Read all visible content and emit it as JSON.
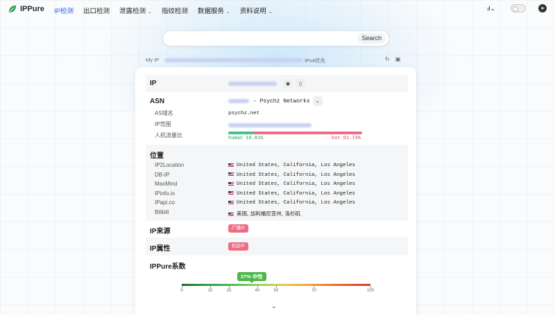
{
  "nav": {
    "brand": "IPPure",
    "items": [
      {
        "label": "IP检测",
        "active": true,
        "dropdown": false
      },
      {
        "label": "出口检测",
        "active": false,
        "dropdown": false
      },
      {
        "label": "泄露检测",
        "active": false,
        "dropdown": true
      },
      {
        "label": "指纹检测",
        "active": false,
        "dropdown": false
      },
      {
        "label": "数据服务",
        "active": false,
        "dropdown": true
      },
      {
        "label": "资料说明",
        "active": false,
        "dropdown": true
      }
    ],
    "brand_color": "#2e9e4f",
    "active_color": "#2563eb"
  },
  "search": {
    "button_label": "Search"
  },
  "myip": {
    "label": "My IP",
    "preference": "IPv4优先"
  },
  "ip_section": {
    "label": "IP"
  },
  "asn": {
    "label": "ASN",
    "org": "- Psychz Networks",
    "domain_label": "AS域名",
    "domain_value": "psychz.net",
    "range_label": "IP范围",
    "traffic_label": "人机流量比",
    "human_text": "human 18.81%",
    "bot_text": "bot 81.19%",
    "human_percent": 18.81,
    "bot_percent": 81.19
  },
  "location": {
    "label": "位置",
    "sources": [
      {
        "name": "IP2Location",
        "value": "United States, California, Los Angeles"
      },
      {
        "name": "DB-IP",
        "value": "United States, California, Los Angeles"
      },
      {
        "name": "MaxMind",
        "value": "United States, California, Los Angeles"
      },
      {
        "name": "IPinfo.io",
        "value": "United States, California, Los Angeles"
      },
      {
        "name": "IPapi.co",
        "value": "United States, California, Los Angeles"
      },
      {
        "name": "Bilibili",
        "value": "美国, 加利福尼亚州, 洛杉矶"
      }
    ]
  },
  "ip_source": {
    "label": "IP来源",
    "badge": "广播IP"
  },
  "ip_attribute": {
    "label": "IP属性",
    "badge": "机房IP"
  },
  "ippure_score": {
    "label": "IPPure系数",
    "badge": "37% 中性",
    "value": 37,
    "ticks": [
      "0",
      "15",
      "25",
      "40",
      "50",
      "70",
      "100"
    ]
  }
}
